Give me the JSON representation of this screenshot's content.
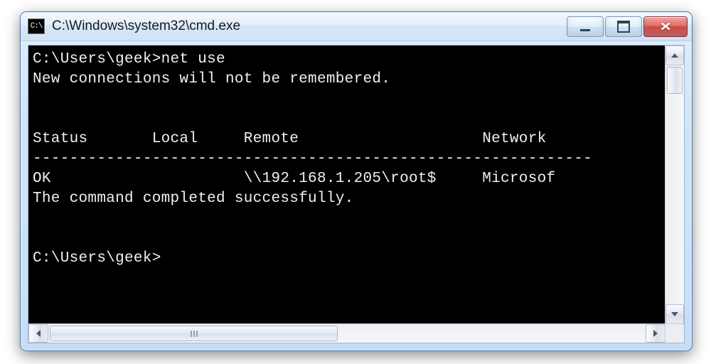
{
  "window": {
    "icon_text": "C:\\",
    "title": "C:\\Windows\\system32\\cmd.exe"
  },
  "console": {
    "line1": "C:\\Users\\geek>net use",
    "line2": "New connections will not be remembered.",
    "blank1": "",
    "blank2": "",
    "header": "Status       Local     Remote                    Network",
    "rule": "-------------------------------------------------------------",
    "row1": "OK                     \\\\192.168.1.205\\root$     Microsof",
    "done": "The command completed successfully.",
    "blank3": "",
    "blank4": "",
    "prompt": "C:\\Users\\geek>"
  }
}
